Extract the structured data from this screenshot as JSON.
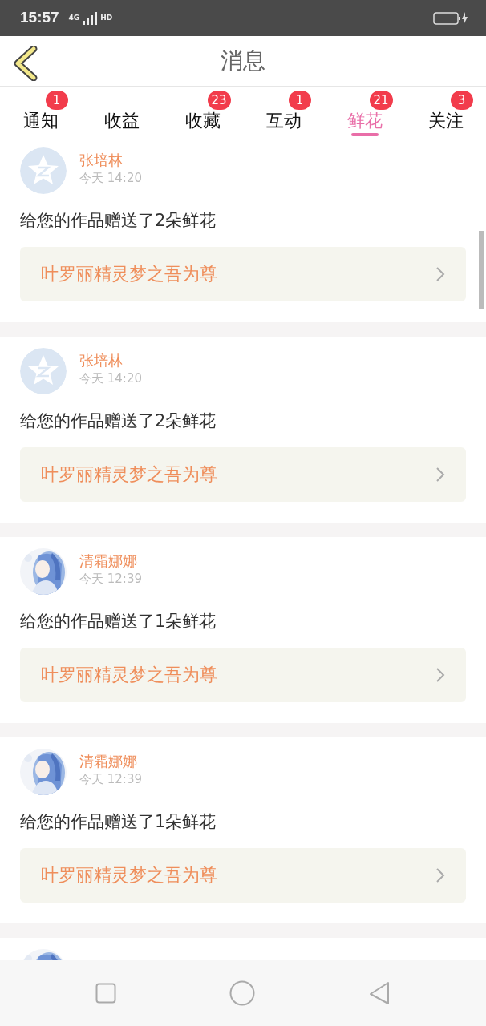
{
  "status_bar": {
    "time": "15:57",
    "network": "4G",
    "hd": "HD"
  },
  "header": {
    "title": "消息"
  },
  "tabs": [
    {
      "label": "通知",
      "badge": "1",
      "selected": false
    },
    {
      "label": "收益",
      "selected": false
    },
    {
      "label": "收藏",
      "badge": "23",
      "selected": false
    },
    {
      "label": "互动",
      "badge": "1",
      "selected": false
    },
    {
      "label": "鲜花",
      "badge": "21",
      "selected": true
    },
    {
      "label": "关注",
      "badge": "3",
      "selected": false
    }
  ],
  "messages": [
    {
      "kind": "default",
      "name": "张培林",
      "time": "今天 14:20",
      "text": "给您的作品赠送了2朵鲜花",
      "work": "叶罗丽精灵梦之吾为尊"
    },
    {
      "kind": "default",
      "name": "张培林",
      "time": "今天 14:20",
      "text": "给您的作品赠送了2朵鲜花",
      "work": "叶罗丽精灵梦之吾为尊"
    },
    {
      "kind": "picture",
      "name": "清霜娜娜",
      "time": "今天 12:39",
      "text": "给您的作品赠送了1朵鲜花",
      "work": "叶罗丽精灵梦之吾为尊"
    },
    {
      "kind": "picture",
      "name": "清霜娜娜",
      "time": "今天 12:39",
      "text": "给您的作品赠送了1朵鲜花",
      "work": "叶罗丽精灵梦之吾为尊"
    },
    {
      "kind": "picture"
    }
  ]
}
